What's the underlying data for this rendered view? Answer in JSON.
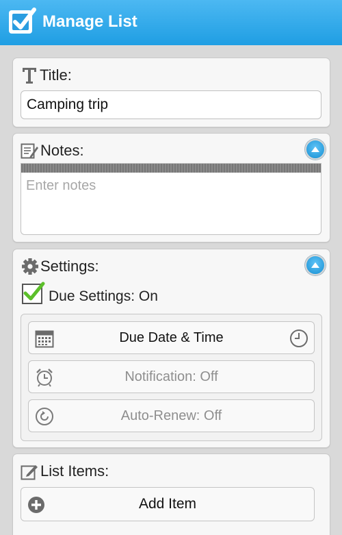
{
  "app": {
    "title": "Manage List"
  },
  "title_section": {
    "label": "Title:",
    "value": "Camping trip"
  },
  "notes_section": {
    "label": "Notes:",
    "placeholder": "Enter notes",
    "value": ""
  },
  "settings_section": {
    "label": "Settings:",
    "due_settings_label": "Due Settings: On",
    "due_settings_checked": true,
    "due_date_button": "Due Date & Time",
    "notification_button": "Notification: Off",
    "auto_renew_button": "Auto-Renew: Off"
  },
  "list_items_section": {
    "label": "List Items:",
    "add_item_button": "Add Item"
  },
  "colors": {
    "app_bar": "#1f9ee3",
    "accent_blue": "#168fd2",
    "check_green": "#5cbf2a",
    "disabled_text": "#8e8e8e"
  },
  "icons": {
    "app_logo": "checkbox-logo-icon",
    "title": "text-t-icon",
    "notes": "notepad-icon",
    "settings": "gear-icon",
    "collapse": "chevron-up-icon",
    "calendar": "calendar-icon",
    "clock": "clock-icon",
    "alarm": "alarm-clock-icon",
    "renew": "renew-icon",
    "list_items": "edit-square-icon",
    "add": "plus-circle-icon"
  }
}
